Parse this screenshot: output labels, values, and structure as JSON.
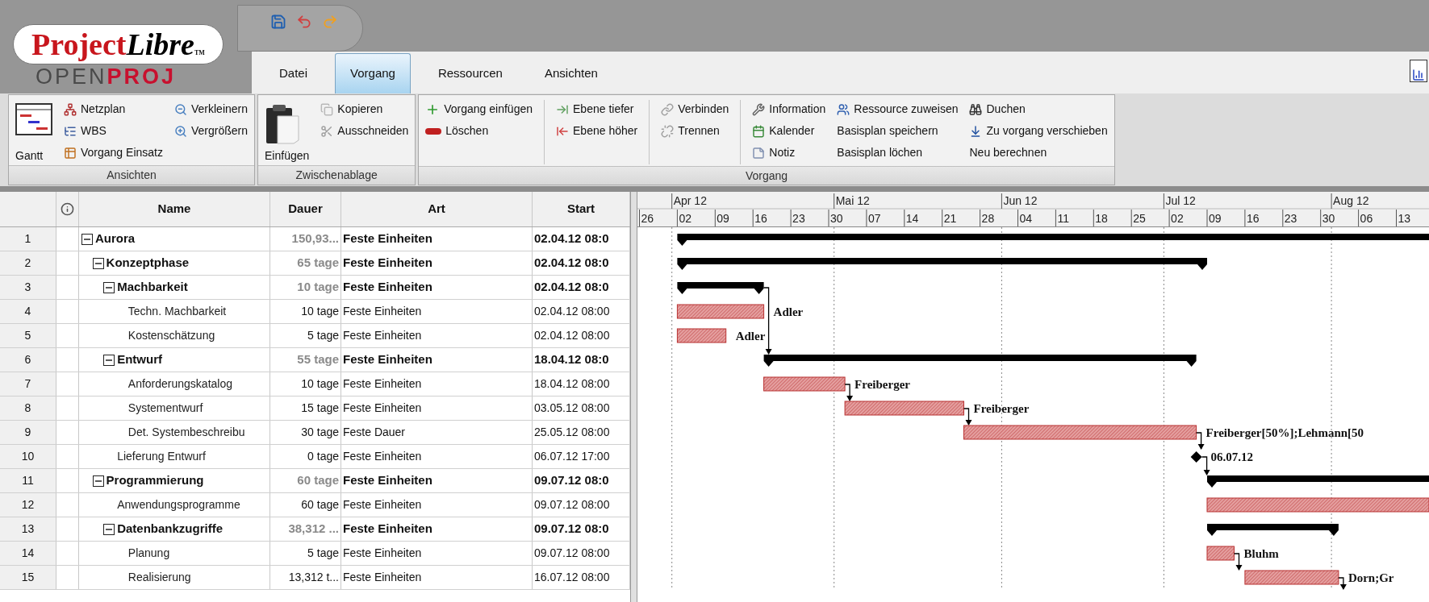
{
  "logo": {
    "part_1": "Project",
    "part_2": "Libre",
    "mark": "TM",
    "sub_1": "OPEN",
    "sub_2": "PROJ"
  },
  "tabs": [
    {
      "label": "Datei",
      "selected": false
    },
    {
      "label": "Vorgang",
      "selected": true
    },
    {
      "label": "Ressourcen",
      "selected": false
    },
    {
      "label": "Ansichten",
      "selected": false
    }
  ],
  "ribbon": {
    "groups": [
      {
        "label": "Ansichten",
        "sections": [
          [
            [
              {
                "label": "Gantt",
                "kind": "large"
              }
            ],
            [
              {
                "label": "Netzplan",
                "kind": "small"
              },
              {
                "label": "WBS",
                "kind": "small"
              },
              {
                "label": "Vorgang Einsatz",
                "kind": "small"
              }
            ],
            [
              {
                "label": "Verkleinern",
                "kind": "small"
              },
              {
                "label": "Vergrößern",
                "kind": "small"
              }
            ]
          ]
        ]
      },
      {
        "label": "Zwischenablage",
        "sections": [
          [
            [
              {
                "label": "Einfügen",
                "kind": "large"
              }
            ],
            [
              {
                "label": "Kopieren",
                "kind": "small"
              },
              {
                "label": "Ausschneiden",
                "kind": "small"
              }
            ]
          ]
        ]
      },
      {
        "label": "Vorgang",
        "sections": [
          [
            [
              {
                "label": "Vorgang einfügen",
                "kind": "small"
              },
              {
                "label": "Löschen",
                "kind": "small"
              }
            ]
          ],
          [
            [
              {
                "label": "Ebene tiefer",
                "kind": "small"
              },
              {
                "label": "Ebene höher",
                "kind": "small"
              }
            ]
          ],
          [
            [
              {
                "label": "Verbinden",
                "kind": "small"
              },
              {
                "label": "Trennen",
                "kind": "small"
              }
            ]
          ],
          [
            [
              {
                "label": "Information",
                "kind": "small"
              },
              {
                "label": "Kalender",
                "kind": "small"
              },
              {
                "label": "Notiz",
                "kind": "small"
              }
            ],
            [
              {
                "label": "Ressource zuweisen",
                "kind": "small"
              },
              {
                "label": "Basisplan speichern",
                "kind": "small"
              },
              {
                "label": "Basisplan löchen",
                "kind": "small"
              }
            ],
            [
              {
                "label": "Duchen",
                "kind": "small"
              },
              {
                "label": "Zu vorgang verschieben",
                "kind": "small"
              },
              {
                "label": "Neu berechnen",
                "kind": "small"
              }
            ]
          ]
        ]
      }
    ]
  },
  "table": {
    "columns": [
      {
        "label": "Name"
      },
      {
        "label": "Dauer"
      },
      {
        "label": "Art"
      },
      {
        "label": "Start"
      }
    ],
    "rows": [
      {
        "number": "1",
        "name": "Aurora",
        "duration": "150,93...",
        "type": "Feste Einheiten",
        "start": "02.04.12 08:0",
        "expanded": true,
        "gantt_bar": {
          "kind": "summary"
        },
        "children": [
          {
            "number": "2",
            "name": "Konzeptphase",
            "duration": "65 tage",
            "type": "Feste Einheiten",
            "start": "02.04.12 08:0",
            "expanded": true,
            "gantt_bar": {
              "kind": "summary"
            },
            "children": [
              {
                "number": "3",
                "name": "Machbarkeit",
                "duration": "10 tage",
                "type": "Feste Einheiten",
                "start": "02.04.12 08:0",
                "expanded": true,
                "gantt_bar": {
                  "kind": "summary",
                  "linked": true
                },
                "children": [
                  {
                    "number": "4",
                    "name": "Techn. Machbarkeit",
                    "duration": "10 tage",
                    "type": "Feste Einheiten",
                    "start": "02.04.12 08:00",
                    "gantt_bar": {
                      "kind": "task",
                      "label": "Adler"
                    }
                  },
                  {
                    "number": "5",
                    "name": "Kostenschätzung",
                    "duration": "5 tage",
                    "type": "Feste Einheiten",
                    "start": "02.04.12 08:00",
                    "gantt_bar": {
                      "kind": "task",
                      "label": "Adler"
                    }
                  }
                ]
              },
              {
                "number": "6",
                "name": "Entwurf",
                "duration": "55 tage",
                "type": "Feste Einheiten",
                "start": "18.04.12 08:0",
                "expanded": true,
                "gantt_bar": {
                  "kind": "summary"
                },
                "children": [
                  {
                    "number": "7",
                    "name": "Anforderungskatalog",
                    "duration": "10 tage",
                    "type": "Feste Einheiten",
                    "start": "18.04.12 08:00",
                    "gantt_bar": {
                      "kind": "task",
                      "label": "Freiberger",
                      "linked": true
                    }
                  },
                  {
                    "number": "8",
                    "name": "Systementwurf",
                    "duration": "15 tage",
                    "type": "Feste Einheiten",
                    "start": "03.05.12 08:00",
                    "gantt_bar": {
                      "kind": "task",
                      "label": "Freiberger",
                      "linked": true
                    }
                  },
                  {
                    "number": "9",
                    "name": "Det. Systembeschreibu",
                    "duration": "30 tage",
                    "type": "Feste Dauer",
                    "start": "25.05.12 08:00",
                    "gantt_bar": {
                      "kind": "task",
                      "label": "Freiberger[50%];Lehmann[50",
                      "linked": true
                    }
                  }
                ]
              },
              {
                "number": "10",
                "name": "Lieferung Entwurf",
                "duration": "0 tage",
                "type": "Feste Einheiten",
                "start": "06.07.12 17:00",
                "gantt_bar": {
                  "kind": "milestone",
                  "label": "06.07.12",
                  "linked": true
                }
              }
            ]
          },
          {
            "number": "11",
            "name": "Programmierung",
            "duration": "60 tage",
            "type": "Feste Einheiten",
            "start": "09.07.12 08:0",
            "expanded": true,
            "gantt_bar": {
              "kind": "summary"
            },
            "children": [
              {
                "number": "12",
                "name": "Anwendungsprogramme",
                "duration": "60 tage",
                "type": "Feste Einheiten",
                "start": "09.07.12 08:00",
                "gantt_bar": {
                  "kind": "task"
                }
              },
              {
                "number": "13",
                "name": "Datenbankzugriffe",
                "duration": "38,312 ...",
                "type": "Feste Einheiten",
                "start": "09.07.12 08:0",
                "expanded": true,
                "gantt_bar": {
                  "kind": "summary"
                },
                "children": [
                  {
                    "number": "14",
                    "name": "Planung",
                    "duration": "5 tage",
                    "type": "Feste Einheiten",
                    "start": "09.07.12 08:00",
                    "gantt_bar": {
                      "kind": "task",
                      "label": "Bluhm",
                      "linked": true
                    }
                  },
                  {
                    "number": "15",
                    "name": "Realisierung",
                    "duration": "13,312 t...",
                    "type": "Feste Einheiten",
                    "start": "16.07.12 08:00",
                    "gantt_bar": {
                      "kind": "task",
                      "label": "Dorn;Gr",
                      "linked": true
                    }
                  }
                ]
              }
            ]
          }
        ]
      }
    ]
  },
  "timeline": {
    "months": [
      "Apr 12",
      "Mai 12",
      "Jun 12",
      "Jul 12",
      "Aug 12"
    ],
    "weeks": [
      "26",
      "02",
      "09",
      "16",
      "23",
      "30",
      "07",
      "14",
      "21",
      "28",
      "04",
      "11",
      "18",
      "25",
      "02",
      "09",
      "16",
      "23",
      "30",
      "06",
      "13"
    ]
  }
}
